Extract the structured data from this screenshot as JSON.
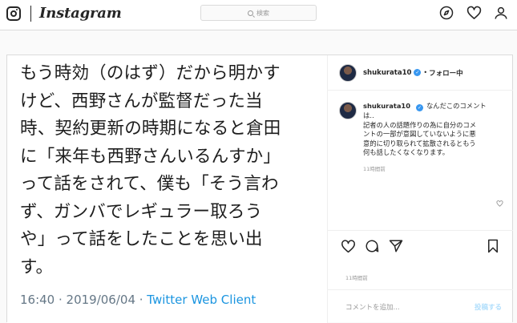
{
  "header": {
    "logo": "Instagram",
    "search_placeholder": "検索",
    "icons": [
      "explore-icon",
      "heart-icon",
      "profile-icon"
    ]
  },
  "post": {
    "tweet": {
      "lines": [
        "もう時効（のはず）だから明かす",
        "けど、西野さんが監督だった当",
        "時、契約更新の時期になると倉田",
        "に「来年も西野さんいるんすか」",
        "って話をされて、僕も「そう言わ",
        "ず、ガンバでレギュラー取ろう",
        "や」って話をしたことを思い出",
        "す。"
      ],
      "meta_time": "16:40 · 2019/06/04 · ",
      "meta_source": "Twitter Web Client"
    },
    "author": {
      "username": "shukurata10",
      "verified_mark": "✓",
      "separator": "•",
      "follow_label": "フォロー中"
    },
    "comment": {
      "username": "shukurata10",
      "text_first": "なんだこのコメント",
      "text_lines": [
        "は‥",
        "記者の人の話題作りの為に自分のコメ",
        "ントの一部が意図していないように悪",
        "意的に切り取られて拡散されるともう",
        "何も話したくなくなります。"
      ],
      "time": "11時間前"
    },
    "post_time": "11時間前",
    "add_comment_placeholder": "コメントを追加...",
    "post_button": "投稿する"
  },
  "colors": {
    "link_blue": "#1b95e0",
    "verified": "#3897f0",
    "border": "#dbdbdb"
  }
}
